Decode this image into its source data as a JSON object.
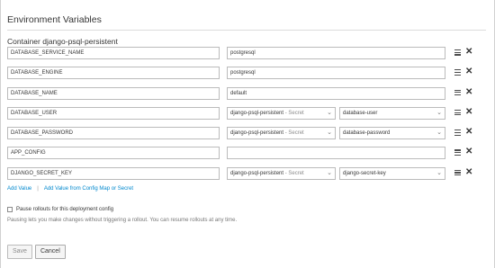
{
  "section": {
    "title": "Environment Variables",
    "container_label": "Container django-psql-persistent"
  },
  "env_vars": [
    {
      "name": "DATABASE_SERVICE_NAME",
      "type": "value",
      "value": "postgresql"
    },
    {
      "name": "DATABASE_ENGINE",
      "type": "value",
      "value": "postgresql"
    },
    {
      "name": "DATABASE_NAME",
      "type": "value",
      "value": "default"
    },
    {
      "name": "DATABASE_USER",
      "type": "secret",
      "secret": "django-psql-persistent",
      "secret_suffix": " - Secret",
      "key": "database-user"
    },
    {
      "name": "DATABASE_PASSWORD",
      "type": "secret",
      "secret": "django-psql-persistent",
      "secret_suffix": " - Secret",
      "key": "database-password"
    },
    {
      "name": "APP_CONFIG",
      "type": "value",
      "value": ""
    },
    {
      "name": "DJANGO_SECRET_KEY",
      "type": "secret",
      "secret": "django-psql-persistent",
      "secret_suffix": " - Secret",
      "key": "django-secret-key"
    }
  ],
  "actions": {
    "add_value": "Add Value",
    "separator": "|",
    "add_value_from": "Add Value from Config Map or Secret"
  },
  "pause": {
    "label": "Pause rollouts for this deployment config",
    "checked": false,
    "help": "Pausing lets you make changes without triggering a rollout. You can resume rollouts at any time."
  },
  "buttons": {
    "save": "Save",
    "cancel": "Cancel"
  },
  "icons": {
    "drag": "drag-handle-icon",
    "remove": "close-icon",
    "chevron": "chevron-down-icon"
  }
}
